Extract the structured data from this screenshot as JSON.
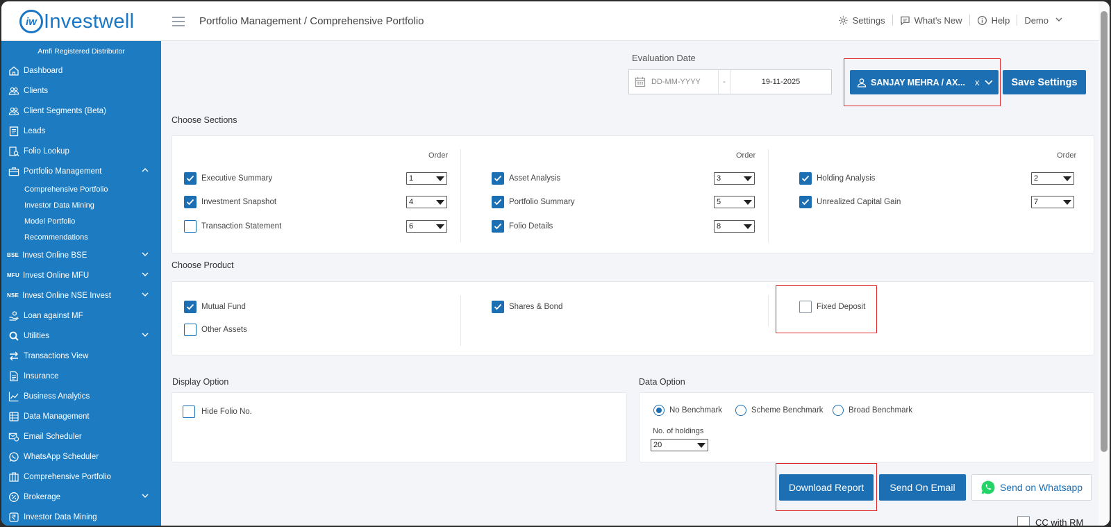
{
  "header": {
    "logo_mark": "iw",
    "logo_text": "Investwell",
    "breadcrumb": "Portfolio Management / Comprehensive Portfolio",
    "nav": {
      "settings": "Settings",
      "whats_new": "What's New",
      "help": "Help",
      "user": "Demo"
    }
  },
  "sidebar": {
    "distributor": "Amfi Registered Distributor",
    "items": [
      {
        "label": "Dashboard",
        "icon": "home-icon"
      },
      {
        "label": "Clients",
        "icon": "users-icon"
      },
      {
        "label": "Client Segments (Beta)",
        "icon": "users-icon"
      },
      {
        "label": "Leads",
        "icon": "clipboard-icon"
      },
      {
        "label": "Folio Lookup",
        "icon": "folio-lookup-icon"
      },
      {
        "label": "Portfolio Management",
        "icon": "briefcase-icon",
        "expanded": true
      },
      {
        "label": "Invest Online BSE",
        "tag": "BSE"
      },
      {
        "label": "Invest Online MFU",
        "tag": "MFU"
      },
      {
        "label": "Invest Online NSE Invest",
        "tag": "NSE"
      },
      {
        "label": "Loan against MF",
        "icon": "hand-money-icon"
      },
      {
        "label": "Utilities",
        "icon": "search-icon"
      },
      {
        "label": "Transactions View",
        "icon": "arrows-icon"
      },
      {
        "label": "Insurance",
        "icon": "document-icon"
      },
      {
        "label": "Business Analytics",
        "icon": "chart-icon"
      },
      {
        "label": "Data Management",
        "icon": "database-icon"
      },
      {
        "label": "Email Scheduler",
        "icon": "mail-clock-icon"
      },
      {
        "label": "WhatsApp Scheduler",
        "icon": "whatsapp-icon"
      },
      {
        "label": "Comprehensive Portfolio",
        "icon": "portfolio-icon"
      },
      {
        "label": "Brokerage",
        "icon": "percent-icon"
      },
      {
        "label": "Investor Data Mining",
        "icon": "rupee-icon"
      }
    ],
    "portfolio_sub": [
      "Comprehensive Portfolio",
      "Investor Data Mining",
      "Model Portfolio",
      "Recommendations"
    ]
  },
  "evaluation": {
    "label": "Evaluation Date",
    "from_placeholder": "DD-MM-YYYY",
    "separator": "-",
    "to_value": "19-11-2025"
  },
  "client_select": {
    "value": "SANJAY MEHRA / AX...",
    "clear": "x"
  },
  "save_settings": "Save Settings",
  "choose_sections": {
    "title": "Choose Sections",
    "order_label": "Order",
    "items": [
      {
        "label": "Executive Summary",
        "checked": true,
        "order": "1"
      },
      {
        "label": "Investment Snapshot",
        "checked": true,
        "order": "4"
      },
      {
        "label": "Transaction Statement",
        "checked": false,
        "order": "6"
      },
      {
        "label": "Asset Analysis",
        "checked": true,
        "order": "3"
      },
      {
        "label": "Portfolio Summary",
        "checked": true,
        "order": "5"
      },
      {
        "label": "Folio Details",
        "checked": true,
        "order": "8"
      },
      {
        "label": "Holding Analysis",
        "checked": true,
        "order": "2"
      },
      {
        "label": "Unrealized Capital Gain",
        "checked": true,
        "order": "7"
      }
    ]
  },
  "choose_product": {
    "title": "Choose Product",
    "items": [
      {
        "label": "Mutual Fund",
        "checked": true
      },
      {
        "label": "Other Assets",
        "checked": false
      },
      {
        "label": "Shares & Bond",
        "checked": true
      },
      {
        "label": "Fixed Deposit",
        "checked": false
      }
    ]
  },
  "display_option": {
    "title": "Display Option",
    "hide_folio": "Hide Folio No."
  },
  "data_option": {
    "title": "Data Option",
    "benchmarks": [
      "No Benchmark",
      "Scheme Benchmark",
      "Broad Benchmark"
    ],
    "selected_benchmark": "No Benchmark",
    "holdings_label": "No. of holdings",
    "holdings_value": "20"
  },
  "actions": {
    "download": "Download Report",
    "email": "Send On Email",
    "whatsapp": "Send on Whatsapp",
    "cc_rm": "CC with RM"
  },
  "colors": {
    "primary": "#1d6fb3",
    "sidebar": "#1d7bc2",
    "highlight": "#e1262c",
    "whatsapp": "#25d366"
  }
}
